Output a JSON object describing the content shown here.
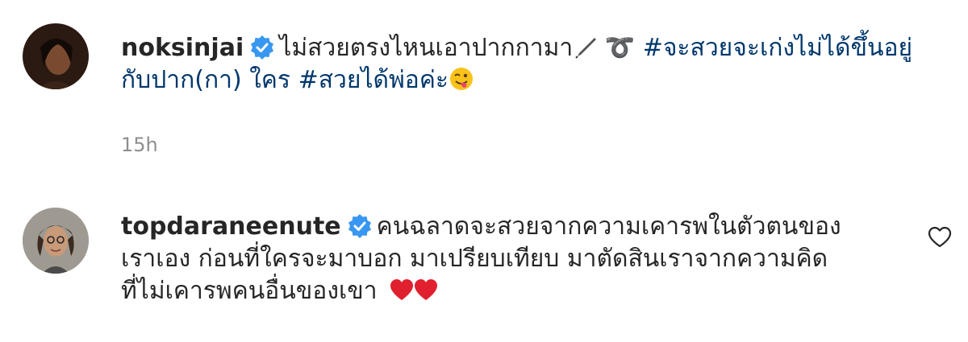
{
  "comments": [
    {
      "username": "noksinjai",
      "verified": true,
      "line1_text": "ไม่สวยตรงไหนเอาปากกามา",
      "line1_mid": " ➰ ",
      "hashtag1": "#จะสวยจะเก่งไม่ได้ขึ้นอยู่",
      "line2_hashtag_cont": "กับปาก(กา) ใคร",
      "hashtag2": "#สวยได้พ่อค่ะ",
      "time": "15h",
      "icons": [
        "pen-icon",
        "curly-loop-icon",
        "winking-tongue-emoji"
      ]
    },
    {
      "username": "topdaraneenute",
      "verified": true,
      "line1": "คนฉลาดจะสวยจากความเคารพในตัวตนของ",
      "line2": "เราเอง ก่อนที่ใครจะมาบอก มาเปรียบเทียบ มาตัดสินเราจากความคิด",
      "line3": "ที่ไม่เคารพคนอื่นของเขา",
      "icons": [
        "red-heart-emoji",
        "red-heart-emoji",
        "like-heart-icon"
      ]
    }
  ],
  "colors": {
    "text": "#262626",
    "hashtag": "#00376b",
    "time": "#8e8e8e",
    "verified": "#3897f0"
  }
}
